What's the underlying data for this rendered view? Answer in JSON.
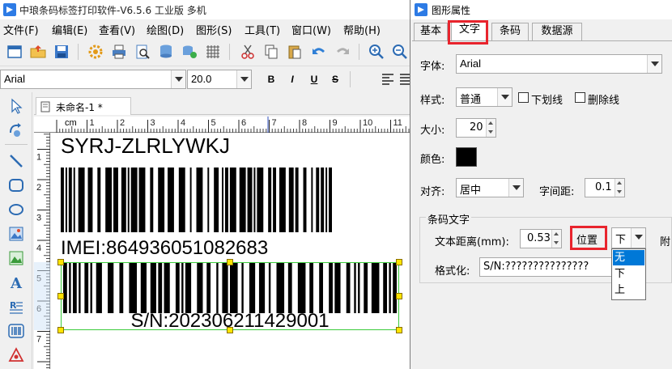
{
  "app": {
    "title": "中琅条码标签打印软件-V6.5.6 工业版 多机",
    "menu": [
      "文件(F)",
      "编辑(E)",
      "查看(V)",
      "绘图(D)",
      "图形(S)",
      "工具(T)",
      "窗口(W)",
      "帮助(H)"
    ],
    "font_name": "Arial",
    "font_size": "20.0",
    "format_buttons": [
      "B",
      "I",
      "U",
      "S"
    ]
  },
  "document": {
    "tab_label": "未命名-1 *",
    "ruler_unit": "cm",
    "ruler_h_ticks": [
      "1",
      "2",
      "3",
      "4",
      "5",
      "6",
      "7",
      "8",
      "9",
      "10",
      "11"
    ],
    "ruler_v_ticks": [
      "1",
      "2",
      "3",
      "4",
      "5",
      "6",
      "7"
    ]
  },
  "canvas": {
    "text_top": "SYRJ-ZLRLYWKJ",
    "barcode1_text": "IMEI:864936051082683",
    "barcode2_text": "S/N:202306211429001"
  },
  "dialog": {
    "title": "图形属性",
    "tabs": [
      "基本",
      "文字",
      "条码",
      "数据源"
    ],
    "active_tab": "文字",
    "font_label": "字体:",
    "font_value": "Arial",
    "style_label": "样式:",
    "style_value": "普通",
    "underline_label": "下划线",
    "strike_label": "删除线",
    "size_label": "大小:",
    "size_value": "20",
    "color_label": "颜色:",
    "color_value": "#000000",
    "align_label": "对齐:",
    "align_value": "居中",
    "spacing_label": "字间距:",
    "spacing_value": "0.1",
    "group_title": "条码文字",
    "distance_label": "文本距离(mm):",
    "distance_value": "0.53",
    "position_label": "位置",
    "position_value": "下",
    "attach_label": "附",
    "format_label": "格式化:",
    "format_value": "S/N:???????????????",
    "position_options": [
      "无",
      "下",
      "上"
    ],
    "position_selected": "无"
  },
  "colors": {
    "accent_blue": "#0078d7",
    "highlight_red": "#e8242d",
    "handle_yellow": "#ffe400",
    "selection_green": "#3ccc3c"
  }
}
